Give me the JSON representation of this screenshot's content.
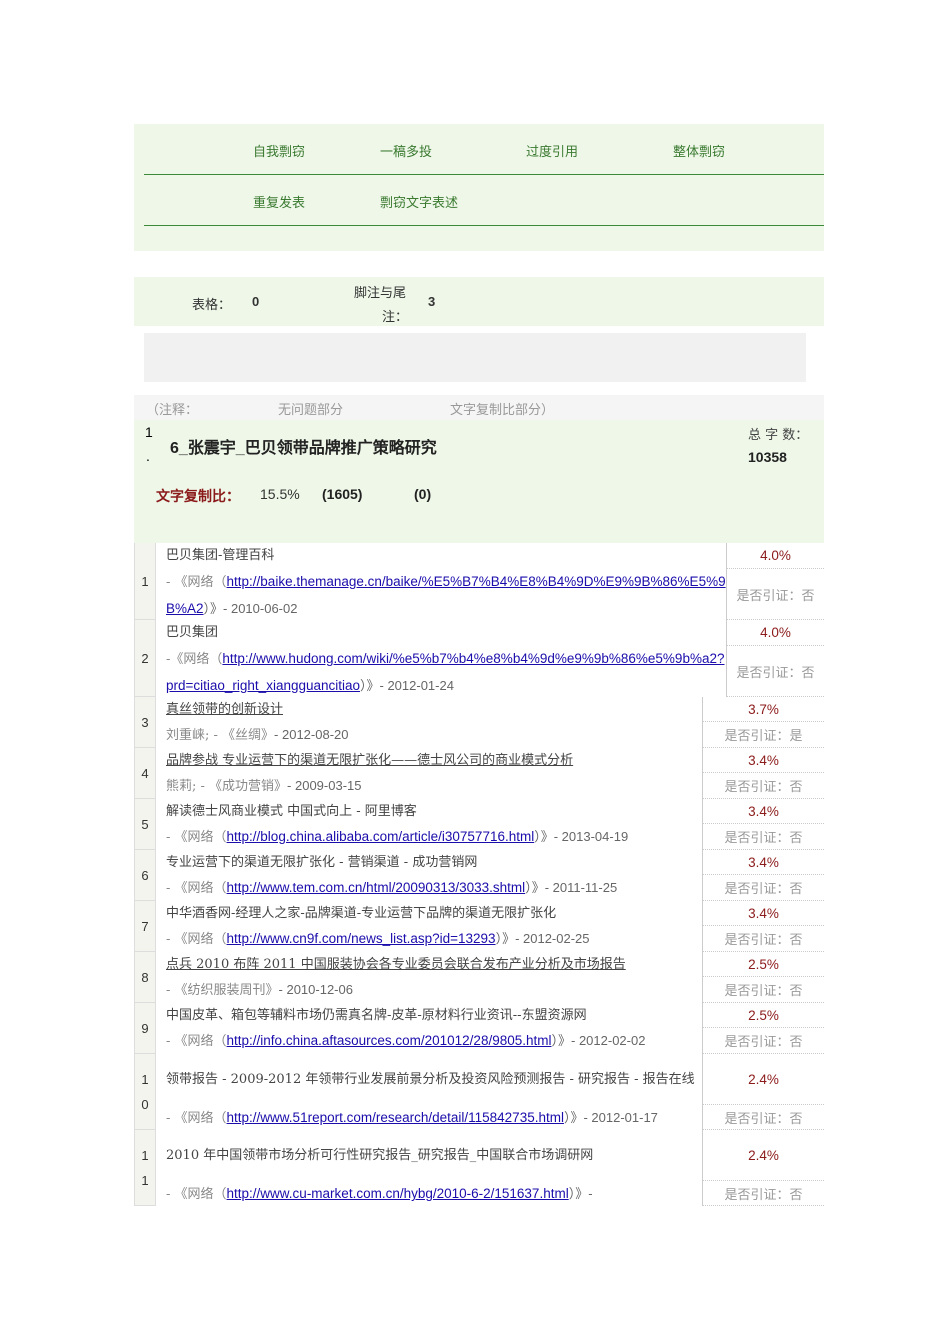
{
  "nav": {
    "row1": [
      "自我剽窃",
      "一稿多投",
      "过度引用",
      "整体剽窃"
    ],
    "row2": [
      "重复发表",
      "剽窃文字表述"
    ]
  },
  "stats": {
    "tables_label": "表格：",
    "tables_value": "0",
    "footnotes_label_1": "脚注与尾",
    "footnotes_label_2": "注：",
    "footnotes_value": "3"
  },
  "note": {
    "prefix": "（注释：",
    "no_issue": "无问题部分",
    "copy_part": "文字复制比部分）"
  },
  "doc": {
    "index": "1",
    "dot": ".",
    "title": "6_张震宇_巴贝领带品牌推广策略研究",
    "total_label": "总 字 数：",
    "total_value": "10358",
    "ratio_label": "文字复制比：",
    "ratio_value": "15.5%",
    "ratio_count": "(1605)",
    "ratio_extra": "(0)"
  },
  "items": [
    {
      "num": [
        "1"
      ],
      "title": "巴贝集团-管理百科",
      "pre": "- 《网络（",
      "url": "http://baike.themanage.cn/baike/%E5%B7%B4%E8%B4%9D%E9%9B%86%E5%9B%A2",
      "post": "）》- 2010-06-02",
      "pct": "4.0%",
      "cite": "是否引证：否"
    },
    {
      "num": [
        "2"
      ],
      "title": "巴贝集团",
      "pre": "-《网络（",
      "url": "http://www.hudong.com/wiki/%e5%b7%b4%e8%b4%9d%e9%9b%86%e5%9b%a2?prd=citiao_right_xiangguancitiao",
      "post": "）》- 2012-01-24",
      "pct": "4.0%",
      "cite": "是否引证：否"
    },
    {
      "num": [
        "3"
      ],
      "title": "真丝领带的创新设计",
      "pre": "刘重崃; - 《丝绸》",
      "post": "- 2012-08-20",
      "pct": "3.7%",
      "cite": "是否引证：是",
      "ul": true
    },
    {
      "num": [
        "4"
      ],
      "title": "品牌参战 专业运营下的渠道无限扩张化——德士风公司的商业模式分析",
      "pre": "熊莉; - 《成功营销》",
      "post": "- 2009-03-15",
      "pct": "3.4%",
      "cite": "是否引证：否",
      "ul": true
    },
    {
      "num": [
        "5"
      ],
      "title": "解读德士风商业模式 中国式向上 - 阿里博客",
      "pre": "- 《网络（",
      "url": "http://blog.china.alibaba.com/article/i30757716.html",
      "post": "）》- 2013-04-19",
      "pct": "3.4%",
      "cite": "是否引证：否"
    },
    {
      "num": [
        "6"
      ],
      "title": "专业运营下的渠道无限扩张化 - 营销渠道 - 成功营销网",
      "pre": "- 《网络（",
      "url": "http://www.tem.com.cn/html/20090313/3033.shtml",
      "post": "）》- 2011-11-25",
      "pct": "3.4%",
      "cite": "是否引证：否"
    },
    {
      "num": [
        "7"
      ],
      "title": "中华酒香网-经理人之家-品牌渠道-专业运营下品牌的渠道无限扩张化",
      "pre": "- 《网络（",
      "url": "http://www.cn9f.com/news_list.asp?id=13293",
      "post": "）》- 2012-02-25",
      "pct": "3.4%",
      "cite": "是否引证：否"
    },
    {
      "num": [
        "8"
      ],
      "title": "点兵 2010 布阵 2011 中国服装协会各专业委员会联合发布产业分析及市场报告",
      "pre": "- 《纺织服装周刊》",
      "post": "- 2010-12-06",
      "pct": "2.5%",
      "cite": "是否引证：否",
      "ul": true
    },
    {
      "num": [
        "9"
      ],
      "title": "中国皮革、箱包等辅料市场仍需真名牌-皮革-原材料行业资讯--东盟资源网",
      "pre": "- 《网络（",
      "url": "http://info.china.aftasources.com/201012/28/9805.html",
      "post": "）》- 2012-02-02",
      "pct": "2.5%",
      "cite": "是否引证：否"
    },
    {
      "num": [
        "1",
        "0"
      ],
      "title": "领带报告 - 2009-2012 年领带行业发展前景分析及投资风险预测报告 - 研究报告 - 报告在线",
      "pre": "- 《网络（",
      "url": "http://www.51report.com/research/detail/115842735.html",
      "post": "）》- 2012-01-17",
      "pct": "2.4%",
      "cite": "是否引证：否"
    },
    {
      "num": [
        "1",
        "1"
      ],
      "title": "2010 年中国领带市场分析可行性研究报告_研究报告_中国联合市场调研网",
      "pre": "- 《网络（",
      "url": "http://www.cu-market.com.cn/hybg/2010-6-2/151637.html",
      "post": "）》-",
      "pct": "2.4%",
      "cite": "是否引证：否"
    }
  ]
}
